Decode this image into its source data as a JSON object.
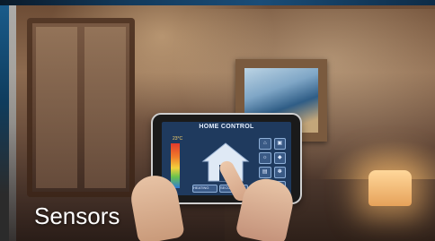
{
  "tile": {
    "caption": "Sensors",
    "tablet": {
      "screen_title": "HOME CONTROL",
      "temperature": "23°C",
      "buttons": [
        "HEATING",
        "SECURITY"
      ]
    }
  },
  "colors": {
    "accent_blue": "#1a4d78",
    "screen_bg": "#1f3a5e",
    "caption_text": "#ffffff"
  }
}
